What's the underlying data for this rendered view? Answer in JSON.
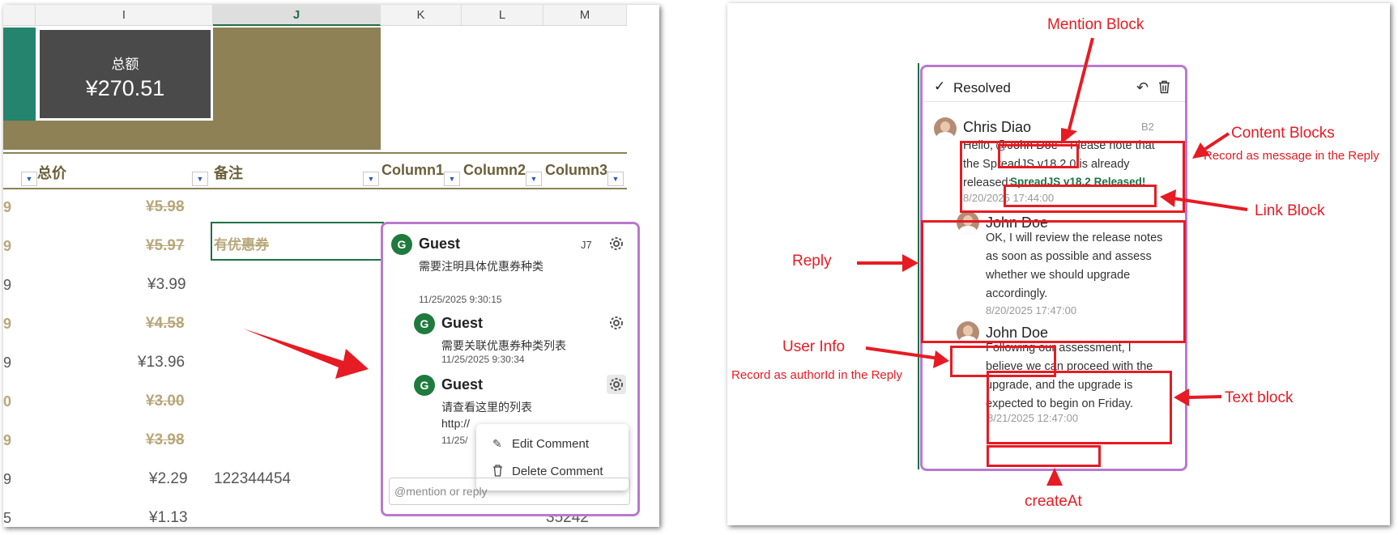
{
  "left": {
    "col_headers": [
      "I",
      "J",
      "K",
      "L",
      "M"
    ],
    "total": {
      "label": "总额",
      "value": "¥270.51"
    },
    "table_headers": [
      "总价",
      "备注",
      "Column1",
      "Column2",
      "Column3"
    ],
    "row_left_digits": [
      "9",
      "9",
      "9",
      "9",
      "9",
      "0",
      "9",
      "9",
      "5"
    ],
    "prices": [
      "¥5.98",
      "¥5.97",
      "¥3.99",
      "¥4.58",
      "¥13.96",
      "¥3.00",
      "¥3.98",
      "¥2.29",
      "¥1.13"
    ],
    "selected_cell": "有优惠券",
    "note_value": "122344454",
    "m_value": "35242",
    "comment": {
      "cell_ref": "J7",
      "entries": [
        {
          "author": "Guest",
          "initial": "G",
          "text": "需要注明具体优惠券种类",
          "time": "11/25/2025 9:30:15"
        },
        {
          "author": "Guest",
          "initial": "G",
          "text": "需要关联优惠券种类列表",
          "time": "11/25/2025 9:30:34"
        },
        {
          "author": "Guest",
          "initial": "G",
          "text": "请查看这里的列表",
          "text2": "http://",
          "time": "11/25/"
        }
      ],
      "menu": [
        "Edit Comment",
        "Delete Comment"
      ],
      "reply_placeholder": "@mention or reply"
    }
  },
  "right": {
    "status": "Resolved",
    "thread": [
      {
        "author": "Chris Diao",
        "ref": "B2",
        "mention": "@John Doe",
        "pre": "Hello,",
        "text": "Please note that the SpreadJS v18.2.0 is already released:",
        "link": "SpreadJS v18.2 Released!",
        "time": "8/20/2025 17:44:00"
      },
      {
        "author": "John Doe",
        "lines": [
          "OK, I will review the release notes",
          "as soon as possible and assess",
          "whether we should upgrade",
          "accordingly."
        ],
        "time": "8/20/2025 17:47:00"
      },
      {
        "author": "John Doe",
        "lines": [
          "Following our assessment, I",
          "believe we can proceed with the",
          "upgrade, and the upgrade is",
          "expected to begin on Friday."
        ],
        "time": "8/21/2025 12:47:00"
      }
    ],
    "annotations": {
      "mention_block": "Mention Block",
      "content_blocks": "Content Blocks",
      "content_note": "Record as message in the Reply",
      "link_block": "Link Block",
      "reply": "Reply",
      "user_info": "User Info",
      "user_note": "Record as authorId in the Reply",
      "text_block": "Text block",
      "create_at": "createAt"
    }
  },
  "colors": {
    "accent_red": "#e61b23",
    "comment_border": "#b979cf",
    "excel_green": "#1e7145",
    "olive": "#8d8155",
    "teal": "#24846e"
  }
}
